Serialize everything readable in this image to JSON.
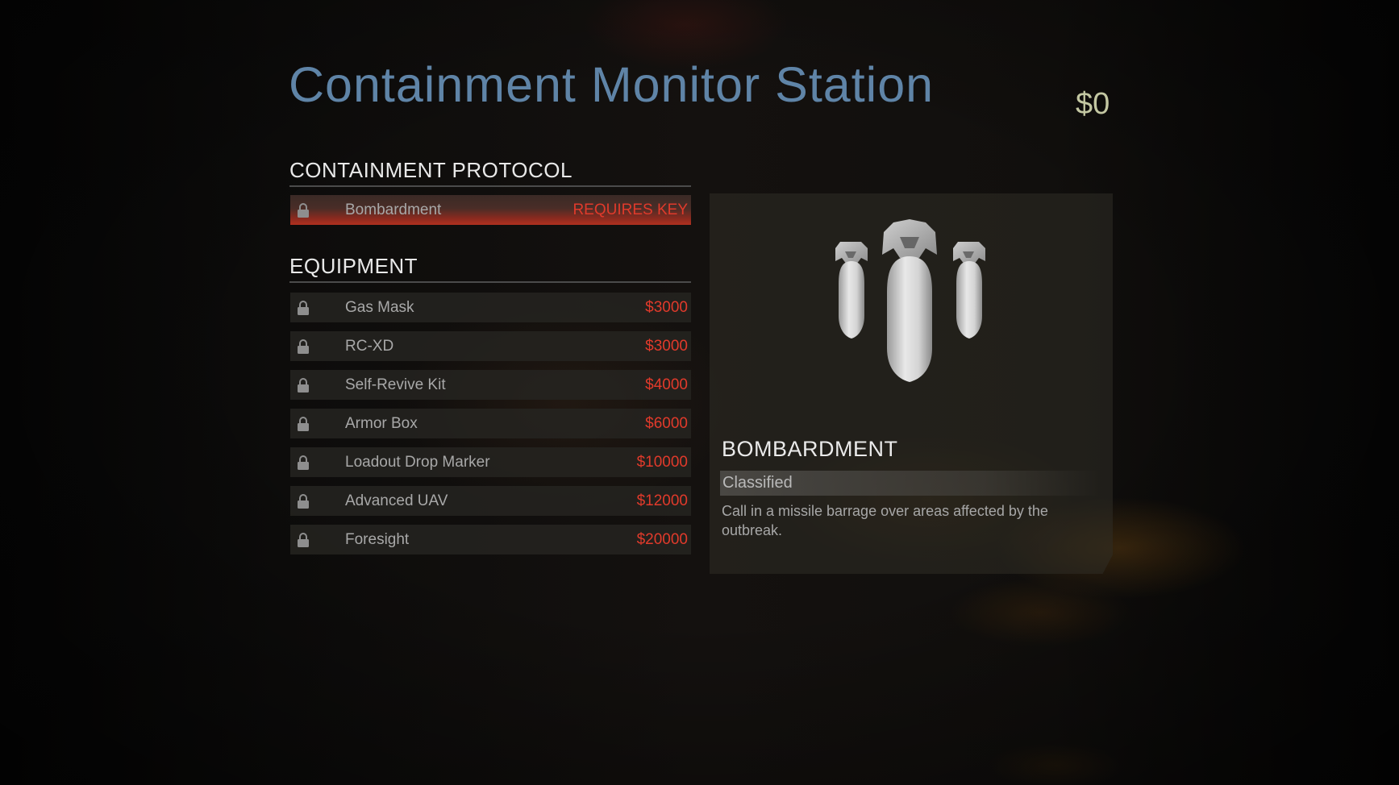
{
  "header": {
    "title": "Containment Monitor Station",
    "money": "$0"
  },
  "sections": {
    "containment_protocol": {
      "title": "CONTAINMENT PROTOCOL",
      "items": [
        {
          "label": "Bombardment",
          "price": "REQUIRES KEY",
          "icon": "lock-icon",
          "selected": true
        }
      ]
    },
    "equipment": {
      "title": "EQUIPMENT",
      "items": [
        {
          "label": "Gas Mask",
          "price": "$3000",
          "icon": "lock-icon"
        },
        {
          "label": "RC-XD",
          "price": "$3000",
          "icon": "lock-icon"
        },
        {
          "label": "Self-Revive Kit",
          "price": "$4000",
          "icon": "lock-icon"
        },
        {
          "label": "Armor Box",
          "price": "$6000",
          "icon": "lock-icon"
        },
        {
          "label": "Loadout Drop Marker",
          "price": "$10000",
          "icon": "lock-icon"
        },
        {
          "label": "Advanced UAV",
          "price": "$12000",
          "icon": "lock-icon"
        },
        {
          "label": "Foresight",
          "price": "$20000",
          "icon": "lock-icon"
        }
      ]
    }
  },
  "detail": {
    "image": "bombs-image",
    "title": "BOMBARDMENT",
    "category": "Classified",
    "description": "Call in a missile barrage over areas affected by the outbreak."
  },
  "colors": {
    "title": "#5f84a7",
    "money": "#c3c7a2",
    "price": "#e13a2b",
    "highlight": "#b0301f"
  }
}
